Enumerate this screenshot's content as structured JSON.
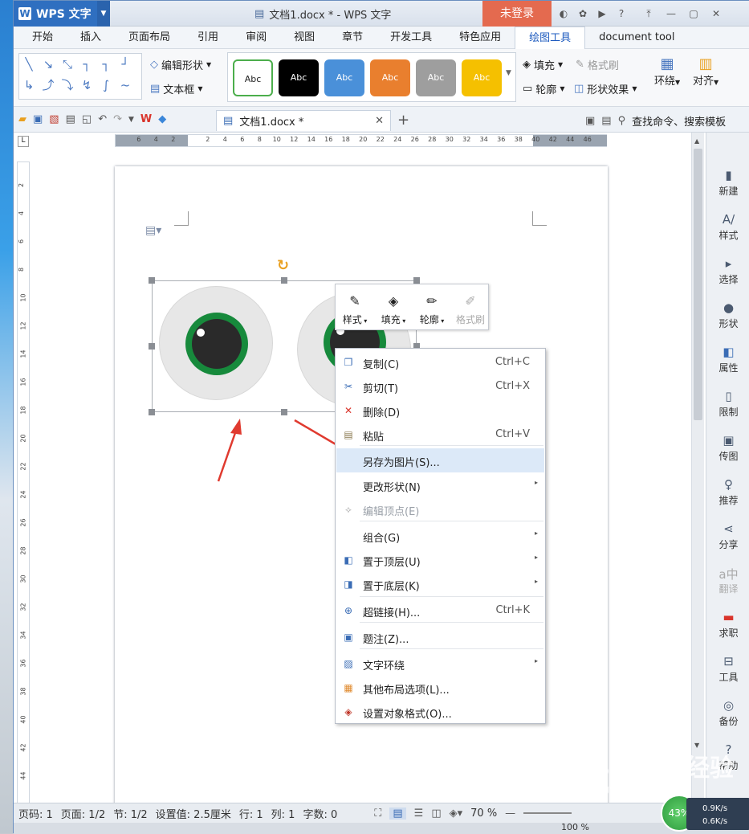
{
  "titlebar": {
    "app_name": "WPS 文字",
    "doc_title": "文档1.docx * - WPS 文字",
    "login": "未登录"
  },
  "menu": [
    "开始",
    "插入",
    "页面布局",
    "引用",
    "审阅",
    "视图",
    "章节",
    "开发工具",
    "特色应用",
    "绘图工具",
    "document tool"
  ],
  "menu_active": "绘图工具",
  "ribbon": {
    "edit_shape": "编辑形状",
    "textbox": "文本框",
    "style_samples": [
      "Abc",
      "Abc",
      "Abc",
      "Abc",
      "Abc",
      "Abc"
    ],
    "style_colors": [
      "#ffffff",
      "#000000",
      "#4a90d9",
      "#e97f2e",
      "#9e9e9e",
      "#f5c000"
    ],
    "fill": "填充",
    "format_brush": "格式刷",
    "outline": "轮廓",
    "shape_effect": "形状效果",
    "wrap": "环绕",
    "align": "对齐"
  },
  "docbar": {
    "tab_title": "文档1.docx *",
    "search": "查找命令、搜索模板"
  },
  "ruler": {
    "numbers": [
      "6",
      "4",
      "2",
      "",
      "2",
      "4",
      "6",
      "8",
      "10",
      "12",
      "14",
      "16",
      "18",
      "20",
      "22",
      "24",
      "26",
      "28",
      "30",
      "32",
      "34",
      "36",
      "38",
      "40",
      "42",
      "44",
      "46"
    ],
    "v_numbers": [
      "2",
      "4",
      "6",
      "8",
      "10",
      "12",
      "14",
      "16",
      "18",
      "20",
      "22",
      "24",
      "26",
      "28",
      "30",
      "32",
      "34",
      "36",
      "38",
      "40",
      "42",
      "44"
    ]
  },
  "minitoolbar": [
    {
      "label": "样式",
      "icon": "pen-style-icon",
      "enabled": true
    },
    {
      "label": "填充",
      "icon": "paint-bucket-icon",
      "enabled": true
    },
    {
      "label": "轮廓",
      "icon": "outline-pen-icon",
      "enabled": true
    },
    {
      "label": "格式刷",
      "icon": "format-brush-icon",
      "enabled": false
    }
  ],
  "context_menu": [
    {
      "label": "复制(C)",
      "shortcut": "Ctrl+C",
      "icon": "copy-icon",
      "arrow": false,
      "enabled": true
    },
    {
      "label": "剪切(T)",
      "shortcut": "Ctrl+X",
      "icon": "scissors-icon",
      "arrow": false,
      "enabled": true
    },
    {
      "label": "删除(D)",
      "shortcut": "",
      "icon": "delete-icon",
      "arrow": false,
      "enabled": true
    },
    {
      "label": "粘贴",
      "shortcut": "Ctrl+V",
      "icon": "paste-icon",
      "arrow": false,
      "enabled": true
    },
    {
      "label": "另存为图片(S)...",
      "shortcut": "",
      "icon": "",
      "arrow": false,
      "enabled": true,
      "highlight": true
    },
    {
      "label": "更改形状(N)",
      "shortcut": "",
      "icon": "",
      "arrow": true,
      "enabled": true
    },
    {
      "label": "编辑顶点(E)",
      "shortcut": "",
      "icon": "edit-points-icon",
      "arrow": false,
      "enabled": false
    },
    {
      "label": "组合(G)",
      "shortcut": "",
      "icon": "",
      "arrow": true,
      "enabled": true
    },
    {
      "label": "置于顶层(U)",
      "shortcut": "",
      "icon": "bring-front-icon",
      "arrow": true,
      "enabled": true
    },
    {
      "label": "置于底层(K)",
      "shortcut": "",
      "icon": "send-back-icon",
      "arrow": true,
      "enabled": true
    },
    {
      "label": "超链接(H)...",
      "shortcut": "Ctrl+K",
      "icon": "hyperlink-icon",
      "arrow": false,
      "enabled": true
    },
    {
      "label": "题注(Z)...",
      "shortcut": "",
      "icon": "caption-icon",
      "arrow": false,
      "enabled": true
    },
    {
      "label": "文字环绕",
      "shortcut": "",
      "icon": "text-wrap-icon",
      "arrow": true,
      "enabled": true
    },
    {
      "label": "其他布局选项(L)...",
      "shortcut": "",
      "icon": "layout-options-icon",
      "arrow": false,
      "enabled": true
    },
    {
      "label": "设置对象格式(O)...",
      "shortcut": "",
      "icon": "object-format-icon",
      "arrow": false,
      "enabled": true
    }
  ],
  "sidepanel": [
    {
      "label": "新建",
      "icon": "new-doc-icon"
    },
    {
      "label": "样式",
      "icon": "style-icon"
    },
    {
      "label": "选择",
      "icon": "select-icon"
    },
    {
      "label": "形状",
      "icon": "shape-icon"
    },
    {
      "label": "属性",
      "icon": "properties-icon"
    },
    {
      "label": "限制",
      "icon": "restrict-icon"
    },
    {
      "label": "传图",
      "icon": "upload-image-icon"
    },
    {
      "label": "推荐",
      "icon": "recommend-icon"
    },
    {
      "label": "分享",
      "icon": "share-icon"
    },
    {
      "label": "翻译",
      "icon": "translate-icon"
    },
    {
      "label": "求职",
      "icon": "job-icon"
    },
    {
      "label": "工具",
      "icon": "toolbox-icon"
    },
    {
      "label": "备份",
      "icon": "backup-icon"
    },
    {
      "label": "帮助",
      "icon": "help-icon"
    }
  ],
  "statusbar": {
    "page_code": "页码: 1",
    "page": "页面: 1/2",
    "section": "节: 1/2",
    "setting": "设置值: 2.5厘米",
    "line": "行: 1",
    "col": "列: 1",
    "words": "字数: 0",
    "zoom": "70 %",
    "zoom_lower": "100 %"
  },
  "overlay": {
    "cpu": "43%",
    "up": "0.9K/s",
    "down": "0.6K/s",
    "watermark": "Bai du 经验",
    "watermark_url": "jingyan.baidu.com"
  }
}
